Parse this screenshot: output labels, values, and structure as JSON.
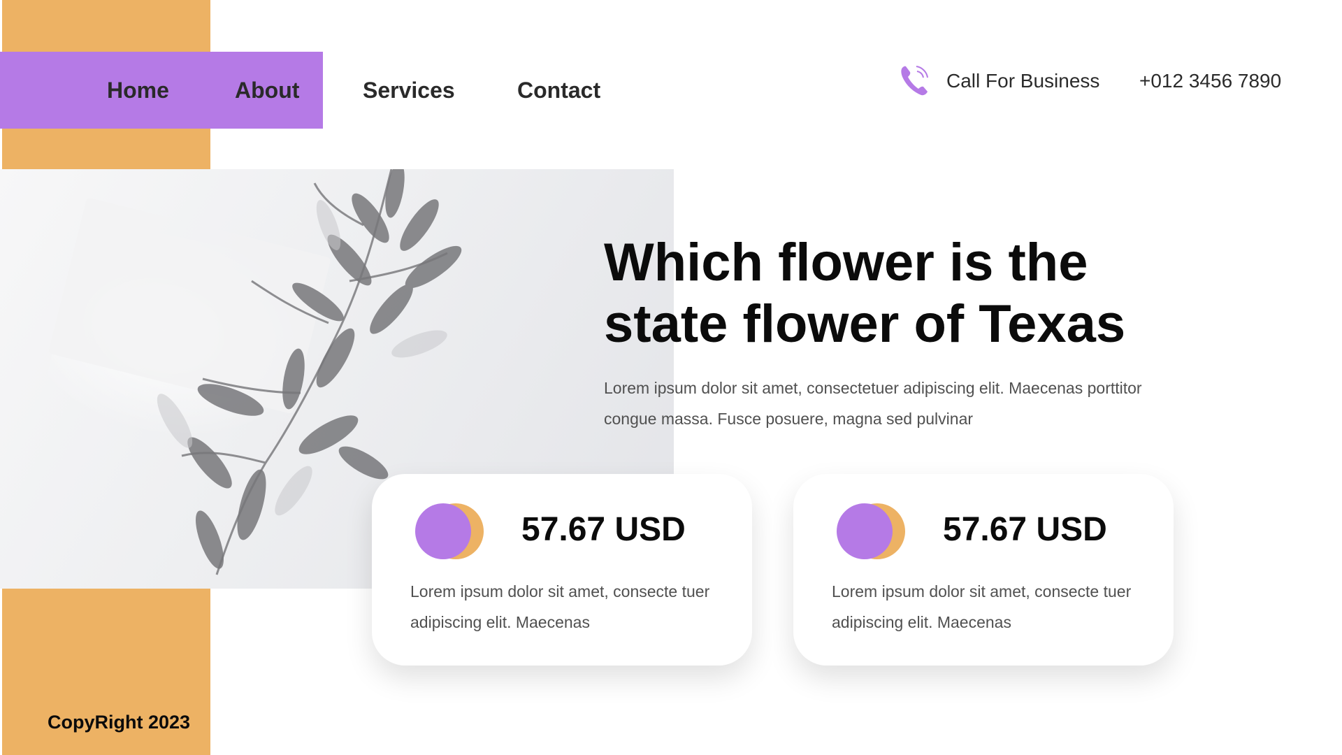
{
  "nav": {
    "items": [
      {
        "label": "Home"
      },
      {
        "label": "About"
      },
      {
        "label": "Services"
      },
      {
        "label": "Contact"
      }
    ]
  },
  "contact": {
    "icon": "phone-icon",
    "call_label": "Call For Business",
    "phone": "+012 3456 7890"
  },
  "hero": {
    "image": "plant-leaves-photo",
    "title": "Which flower is the\nstate flower of Texas",
    "text": "Lorem ipsum dolor sit amet, consectetuer adipiscing elit. Maecenas porttitor congue massa. Fusce posuere, magna sed pulvinar"
  },
  "cards": [
    {
      "price": "57.67 USD",
      "text": "Lorem ipsum dolor sit amet, consecte tuer adipiscing elit. Maecenas"
    },
    {
      "price": "57.67 USD",
      "text": "Lorem ipsum dolor sit amet, consecte tuer adipiscing elit. Maecenas"
    }
  ],
  "footer": {
    "copyright": "CopyRight 2023"
  },
  "colors": {
    "accent_purple": "#B57AE6",
    "accent_orange": "#EDB264",
    "text_dark": "#0B0B0B",
    "text_body": "#505050"
  }
}
